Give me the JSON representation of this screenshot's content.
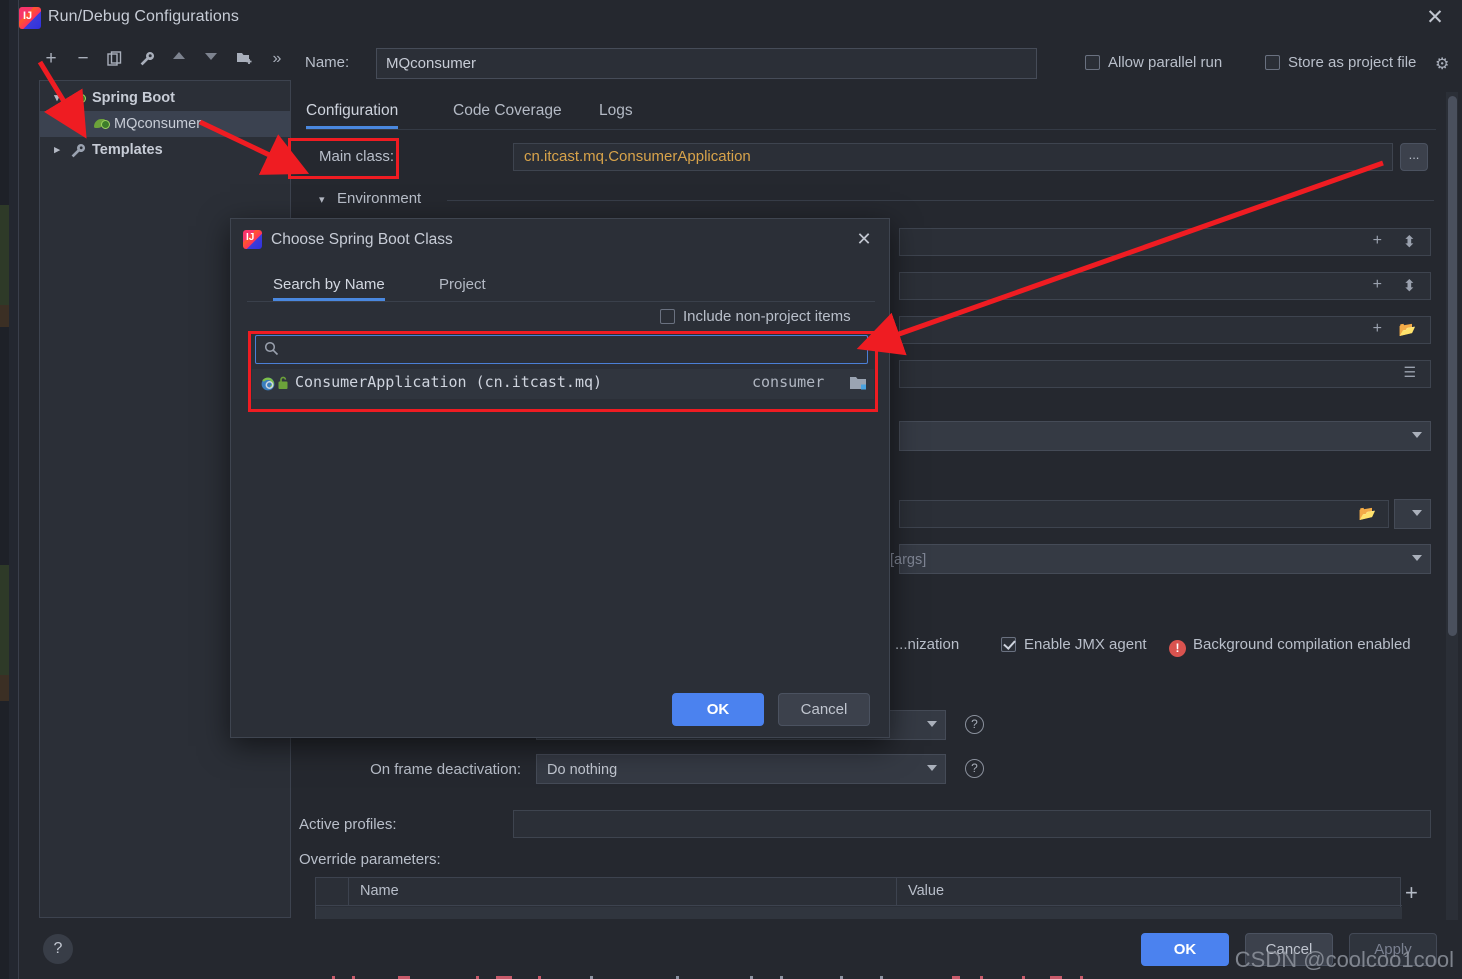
{
  "window": {
    "title": "Run/Debug Configurations",
    "close_icon": "close-icon",
    "logo_icon": "intellij-logo-icon"
  },
  "toolbar": {
    "items": [
      {
        "name": "add-configuration",
        "icon": "plus-icon",
        "glyph": "+"
      },
      {
        "name": "remove-configuration",
        "icon": "minus-icon",
        "glyph": "−"
      },
      {
        "name": "copy-configuration",
        "icon": "copy-icon",
        "glyph": "⧉"
      },
      {
        "name": "edit-templates",
        "icon": "wrench-icon",
        "glyph": "🔧"
      },
      {
        "name": "move-up",
        "icon": "arrow-up-icon",
        "glyph": "▲"
      },
      {
        "name": "move-down",
        "icon": "arrow-down-icon",
        "glyph": "▼"
      },
      {
        "name": "new-folder",
        "icon": "folder-add-icon",
        "glyph": "📁"
      },
      {
        "name": "more-options",
        "icon": "chevron-double-right-icon",
        "glyph": "»"
      }
    ]
  },
  "tree": {
    "items": [
      {
        "label": "Spring Boot",
        "icon": "spring-boot-icon",
        "expanded": true,
        "selected": false,
        "level": 0
      },
      {
        "label": "MQconsumer",
        "icon": "spring-boot-icon",
        "expanded": false,
        "selected": true,
        "level": 1
      },
      {
        "label": "Templates",
        "icon": "wrench-icon",
        "expanded": false,
        "selected": false,
        "level": 0
      }
    ]
  },
  "header": {
    "name_label": "Name:",
    "name_value": "MQconsumer",
    "allow_parallel_run": "Allow parallel run",
    "allow_parallel_run_checked": false,
    "store_as_project_file": "Store as project file",
    "store_as_project_file_checked": false,
    "settings_icon": "gear-icon"
  },
  "tabs": [
    {
      "label": "Configuration",
      "active": true
    },
    {
      "label": "Code Coverage",
      "active": false
    },
    {
      "label": "Logs",
      "active": false
    }
  ],
  "configuration": {
    "main_class_label": "Main class:",
    "main_class_value": "cn.itcast.mq.ConsumerApplication",
    "main_class_color": "#d8a34a",
    "browse_button_label": "...",
    "environment_label": "Environment",
    "vm_options_row_icons": [
      "plus-icon",
      "expand-icon"
    ],
    "program_arguments_row_icons": [
      "plus-icon",
      "expand-icon"
    ],
    "working_directory_row_icons": [
      "plus-icon",
      "folder-icon"
    ],
    "environment_variables_row_icons": [
      "list-icon"
    ],
    "jre_placeholder": "",
    "shorten_command_line_placeholder": "",
    "active_profiles_label": "Active profiles:",
    "active_profiles_value": "",
    "override_parameters_label": "Override parameters:",
    "spring_boot_settings": {
      "optimization_label": "...nization",
      "enable_jmx_agent": "Enable JMX agent",
      "enable_jmx_agent_checked": true,
      "background_compilation": "Background compilation enabled",
      "background_compilation_icon": "warning-icon"
    },
    "on_update_action_label": "",
    "on_frame_deactivation_label": "On frame deactivation:",
    "on_frame_deactivation_value": "Do nothing",
    "args_placeholder": "[args]",
    "help_icon": "question-circle-icon"
  },
  "override_table": {
    "columns": [
      "Name",
      "Value"
    ],
    "rows": [],
    "add_icon": "plus-icon"
  },
  "footer": {
    "help_label": "?",
    "ok": "OK",
    "cancel": "Cancel",
    "apply": "Apply",
    "apply_disabled": true
  },
  "choose_dialog": {
    "title": "Choose Spring Boot Class",
    "close_icon": "close-icon",
    "tabs": [
      {
        "label": "Search by Name",
        "active": true
      },
      {
        "label": "Project",
        "active": false
      }
    ],
    "include_non_project_items": "Include non-project items",
    "include_non_project_items_checked": false,
    "search_placeholder": "",
    "search_value": "",
    "search_icon": "search-icon",
    "results": [
      {
        "name": "ConsumerApplication (cn.itcast.mq)",
        "module": "consumer",
        "class_icon": "spring-boot-class-icon",
        "lock_icon": "public-lock-icon",
        "module_icon": "module-icon"
      }
    ],
    "ok": "OK",
    "cancel": "Cancel"
  },
  "annotations": {
    "accent_color": "#ef1c22",
    "boxes": [
      "main-class-label-highlight",
      "search-and-result-highlight"
    ],
    "arrows": [
      "arrow-to-add-button",
      "arrow-to-main-class",
      "arrow-to-browse-button"
    ]
  },
  "watermark": "CSDN @coolcoo1cool"
}
